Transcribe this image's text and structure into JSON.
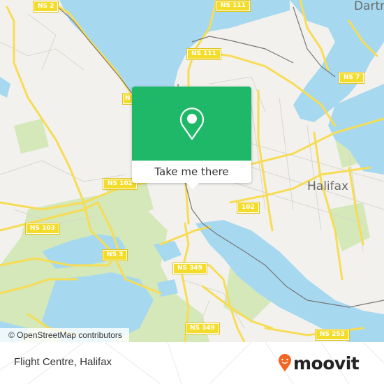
{
  "map": {
    "road_labels": [
      {
        "id": "ns2",
        "text": "NS 2"
      },
      {
        "id": "ns111a",
        "text": "NS 111"
      },
      {
        "id": "ns111b",
        "text": "NS 111"
      },
      {
        "id": "ns7",
        "text": "NS 7"
      },
      {
        "id": "ns102",
        "text": "NS 102"
      },
      {
        "id": "ns103",
        "text": "NS 103"
      },
      {
        "id": "ns3",
        "text": "NS 3"
      },
      {
        "id": "r102",
        "text": "102"
      },
      {
        "id": "ns349a",
        "text": "NS 349"
      },
      {
        "id": "ns349b",
        "text": "NS 349"
      },
      {
        "id": "ns253",
        "text": "NS 253"
      },
      {
        "id": "nsleft",
        "text": "N"
      }
    ],
    "place_labels": {
      "halifax": "Halifax",
      "dartmouth": "Dartm"
    },
    "attribution": "© OpenStreetMap contributors",
    "colors": {
      "water": "#a6d9ef",
      "land": "#f2f1ee",
      "park": "#cfe6b0",
      "road": "#f7dc55",
      "rail": "#777777"
    }
  },
  "popup": {
    "icon": "map-pin-icon",
    "button_label": "Take me there",
    "color": "#1fb868"
  },
  "footer": {
    "title": "Flight Centre, Halifax",
    "brand": "moovit",
    "brand_color": "#f26522"
  }
}
